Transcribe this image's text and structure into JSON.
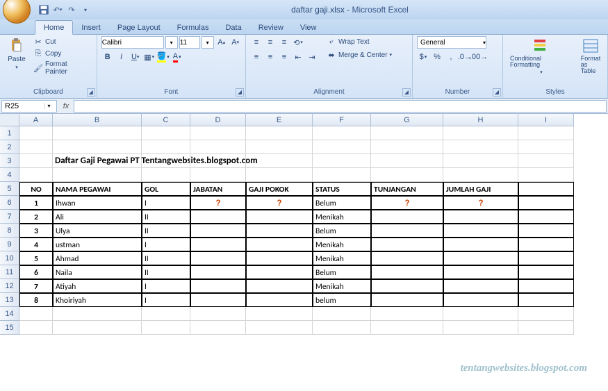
{
  "titlebar": {
    "filename": "daftar gaji.xlsx",
    "app": "Microsoft Excel"
  },
  "qat": {
    "save": "save-icon",
    "undo": "undo-icon",
    "redo": "redo-icon"
  },
  "tabs": [
    "Home",
    "Insert",
    "Page Layout",
    "Formulas",
    "Data",
    "Review",
    "View"
  ],
  "active_tab": 0,
  "ribbon": {
    "clipboard": {
      "paste": "Paste",
      "cut": "Cut",
      "copy": "Copy",
      "format_painter": "Format Painter",
      "label": "Clipboard"
    },
    "font": {
      "name": "Calibri",
      "size": "11",
      "label": "Font"
    },
    "alignment": {
      "wrap": "Wrap Text",
      "merge": "Merge & Center",
      "label": "Alignment"
    },
    "number": {
      "format": "General",
      "label": "Number"
    },
    "styles": {
      "cond": "Conditional Formatting",
      "fmt": "Format as Table",
      "label": "Styles"
    }
  },
  "namebox": "R25",
  "formula": "",
  "columns": [
    "A",
    "B",
    "C",
    "D",
    "E",
    "F",
    "G",
    "H",
    "I"
  ],
  "row_count": 15,
  "sheet_title": "Daftar Gaji Pegawai PT Tentangwebsites.blogspot.com",
  "headers": [
    "NO",
    "NAMA PEGAWAI",
    "GOL",
    "JABATAN",
    "GAJI POKOK",
    "STATUS",
    "TUNJANGAN",
    "JUMLAH GAJI"
  ],
  "rows": [
    {
      "no": "1",
      "nama": "Ihwan",
      "gol": "I",
      "jabatan": "?",
      "gaji": "?",
      "status": "Belum",
      "tunj": "?",
      "jumlah": "?"
    },
    {
      "no": "2",
      "nama": "Ali",
      "gol": "II",
      "jabatan": "",
      "gaji": "",
      "status": "Menikah",
      "tunj": "",
      "jumlah": ""
    },
    {
      "no": "3",
      "nama": "Ulya",
      "gol": "II",
      "jabatan": "",
      "gaji": "",
      "status": "Belum",
      "tunj": "",
      "jumlah": ""
    },
    {
      "no": "4",
      "nama": "ustman",
      "gol": "I",
      "jabatan": "",
      "gaji": "",
      "status": "Menikah",
      "tunj": "",
      "jumlah": ""
    },
    {
      "no": "5",
      "nama": "Ahmad",
      "gol": "II",
      "jabatan": "",
      "gaji": "",
      "status": "Menikah",
      "tunj": "",
      "jumlah": ""
    },
    {
      "no": "6",
      "nama": "Naila",
      "gol": "II",
      "jabatan": "",
      "gaji": "",
      "status": "Belum",
      "tunj": "",
      "jumlah": ""
    },
    {
      "no": "7",
      "nama": "Atiyah",
      "gol": "I",
      "jabatan": "",
      "gaji": "",
      "status": "Menikah",
      "tunj": "",
      "jumlah": ""
    },
    {
      "no": "8",
      "nama": "Khoiriyah",
      "gol": "I",
      "jabatan": "",
      "gaji": "",
      "status": "belum",
      "tunj": "",
      "jumlah": ""
    }
  ],
  "watermark": "tentangwebsites.blogspot.com"
}
